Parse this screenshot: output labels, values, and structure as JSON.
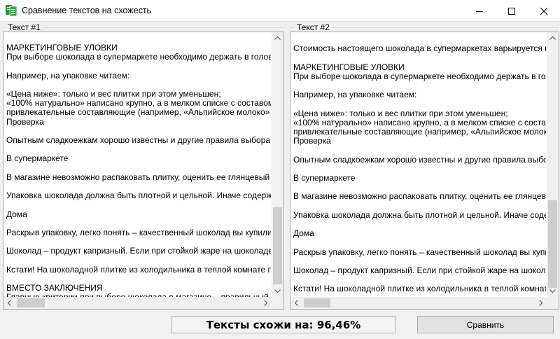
{
  "window": {
    "title": "Сравнение текстов на схожесть"
  },
  "text1": {
    "label": "Текст #1",
    "lines": "МАРКЕТИНГОВЫЕ УЛОВКИ\nПри выборе шоколада в супермаркете необходимо держать в голове прие\n\nНапример, на упаковке читаем:\n\n«Цена ниже»: только и вес плитки при этом уменьшен;\n«100% натурально» написано крупно, а в мелком списке с составом есть и\nпривлекательные составляющие (например, «Альпийское молоко» или «С\nПроверка\n\nОпытным сладкоежкам хорошо известны и другие правила выбора шокол\n\nВ супермаркете\n\nВ магазине невозможно распаковать плитку, оценить ее глянцевый блеск\n\nУпаковка шоколада должна быть плотной и цельной. Иначе содержимое п\n\nДома\n\nРаскрыв упаковку, легко понять – качественный шоколад вы купили в ма\n\nШоколад – продукт капризный. Если при стойкой жаре на шоколаде прост\n\nКстати! На шоколадной плитке из холодильника в теплой комнате появля\n\nВМЕСТО ЗАКЛЮЧЕНИЯ\nГлавные критерии при выборе шоколада в магазине – правильный состав"
  },
  "text2": {
    "label": "Текст #2",
    "lines": "\nСтоимость настоящего шоколада в супермаркетах варьируется в диа\n\nМАРКЕТИНГОВЫЕ УЛОВКИ\nПри выборе шоколада в супермаркете необходимо держать в голове\n\nНапример, на упаковке читаем:\n\n«Цена ниже»: только и вес плитки при этом уменьшен;\n«100% натурально» написано крупно, а в мелком списке с составом е\nпривлекательные составляющие (например, «Альпийское молоко» ил\nПроверка\n\nОпытным сладкоежкам хорошо известны и другие правила выбора ш\n\nВ супермаркете\n\nВ магазине невозможно распаковать плитку, оценить ее глянцевый б\n\nУпаковка шоколада должна быть плотной и цельной. Иначе содержим\n\nДома\n\nРаскрыв упаковку, легко понять – качественный шоколад вы купили\n\nШоколад – продукт капризный. Если при стойкой жаре на шоколаде п\n\nКстати! На шоколадной плитке из холодильника в теплой комнате по\n\nВМЕСТО ЗАКЛЮЧЕНИЯ\nГлавные критерии при выборе шоколада в магазине – правильный сос"
  },
  "result": {
    "text": "Тексты схожи на: 96,46%"
  },
  "compare_button": {
    "label": "Сравнить"
  },
  "colors": {
    "accent": "#0078d7",
    "app_icon_green": "#2e8b3a"
  }
}
